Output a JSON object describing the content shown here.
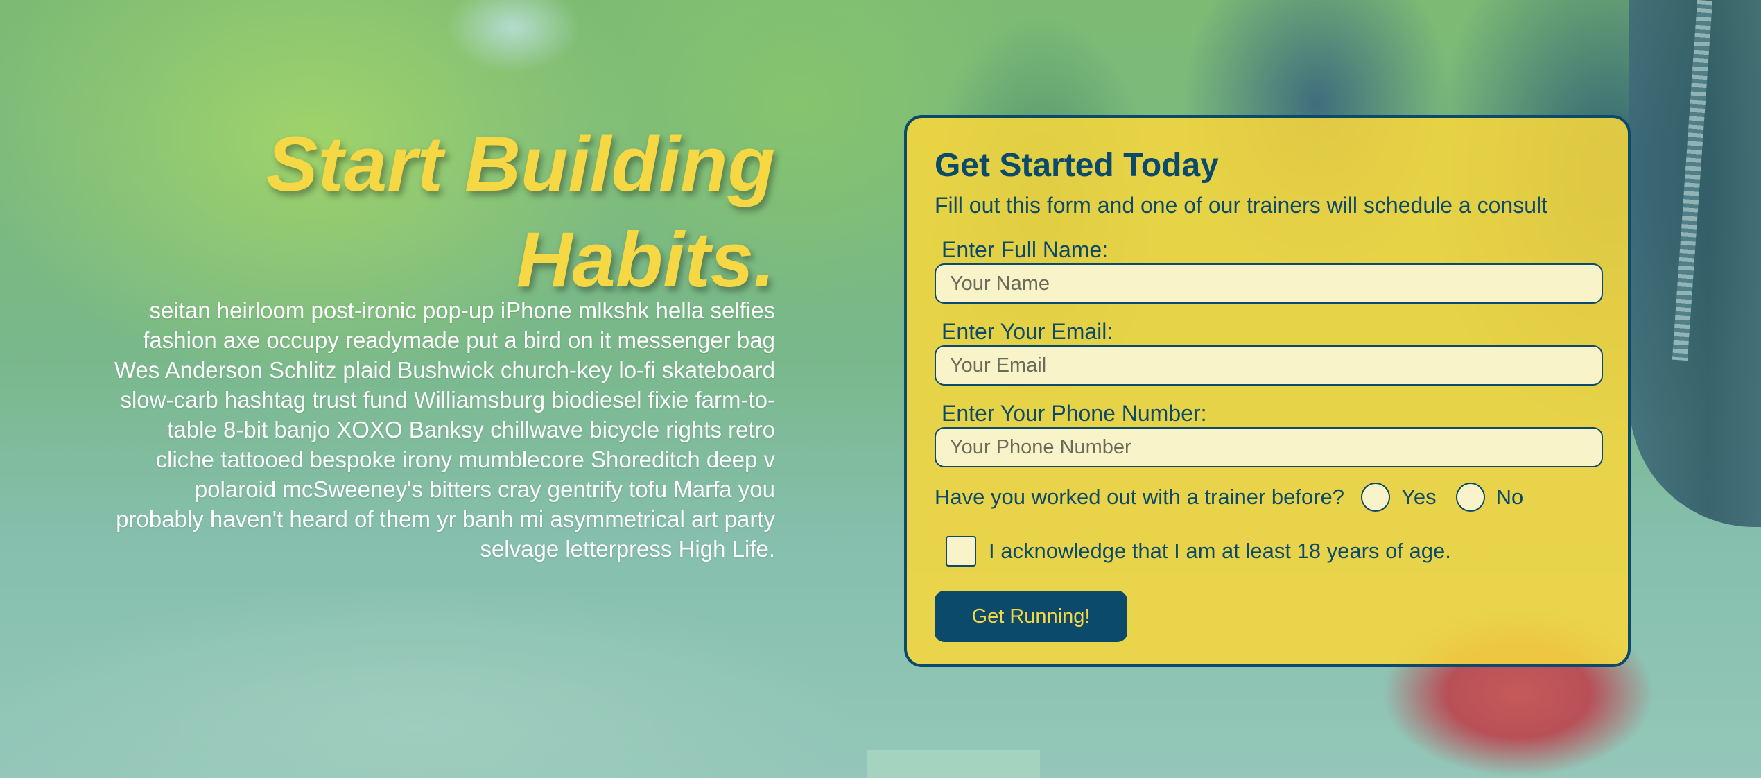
{
  "hero": {
    "title_line1": "Start Building",
    "title_line2": "Habits.",
    "body": "seitan heirloom post-ironic pop-up iPhone mlkshk hella selfies fashion axe occupy readymade put a bird on it messenger bag Wes Anderson Schlitz plaid Bushwick church-key lo-fi skateboard slow-carb hashtag trust fund Williamsburg biodiesel fixie farm-to-table 8-bit banjo XOXO Banksy chillwave bicycle rights retro cliche tattooed bespoke irony mumblecore Shoreditch deep v polaroid mcSweeney's bitters cray gentrify tofu Marfa you probably haven't heard of them yr banh mi asymmetrical art party selvage letterpress High Life."
  },
  "form": {
    "title": "Get Started Today",
    "subtitle": "Fill out this form and one of our trainers will schedule a consult",
    "name_label": "Enter Full Name:",
    "name_placeholder": "Your Name",
    "email_label": "Enter Your Email:",
    "email_placeholder": "Your Email",
    "phone_label": "Enter Your Phone Number:",
    "phone_placeholder": "Your Phone Number",
    "trainer_question": "Have you worked out with a trainer before?",
    "trainer_yes": "Yes",
    "trainer_no": "No",
    "age_ack": "I acknowledge that I am at least 18 years of age.",
    "submit_label": "Get Running!"
  },
  "colors": {
    "accent_yellow": "#f6d845",
    "navy": "#0b4a6a",
    "input_bg": "#f9f3c9"
  }
}
